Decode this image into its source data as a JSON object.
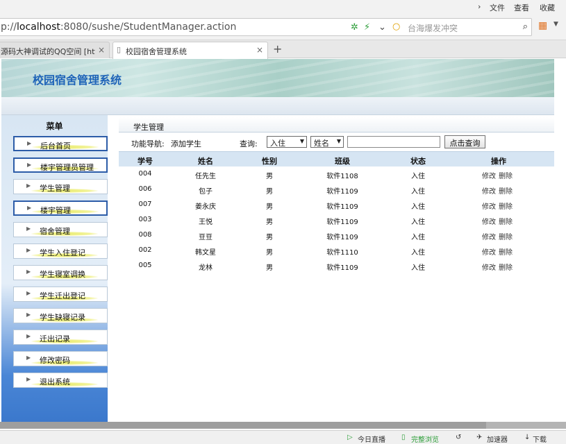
{
  "browser": {
    "menu": [
      "文件",
      "查看",
      "收藏"
    ],
    "url_prefix": "p://",
    "url_host": "localhost",
    "url_rest": ":8080/sushe/StudentManager.action",
    "search_placeholder": "台海爆发冲突",
    "tabs": [
      {
        "label": "源码大神调试的QQ空间 [http:",
        "active": false
      },
      {
        "label": "校园宿舍管理系统",
        "active": true
      }
    ],
    "new_tab": "+",
    "status": [
      "今日直播",
      "完整浏览",
      "加速器",
      "下载"
    ]
  },
  "header": {
    "system_title": "校园宿舍管理系统"
  },
  "sidebar": {
    "title": "菜单",
    "items": [
      {
        "label": "后台首页"
      },
      {
        "label": "楼宇管理员管理"
      },
      {
        "label": "学生管理"
      },
      {
        "label": "楼宇管理"
      },
      {
        "label": "宿舍管理"
      },
      {
        "label": "学生入住登记"
      },
      {
        "label": "学生寝室调换"
      },
      {
        "label": "学生迁出登记"
      },
      {
        "label": "学生缺寝记录"
      },
      {
        "label": "迁出记录"
      },
      {
        "label": "修改密码"
      },
      {
        "label": "退出系统"
      }
    ]
  },
  "main": {
    "breadcrumb": "学生管理",
    "toolbar": {
      "nav_label": "功能导航:",
      "add_link": "添加学生",
      "query_label": "查询:",
      "status_select": "入住",
      "field_select": "姓名",
      "query_value": "",
      "query_button": "点击查询"
    },
    "columns": [
      "学号",
      "姓名",
      "性别",
      "班级",
      "状态",
      "操作"
    ],
    "rows": [
      {
        "id": "004",
        "name": "任先生",
        "sex": "男",
        "class": "软件1108",
        "status": "入住",
        "edit": "修改",
        "delete": "删除"
      },
      {
        "id": "006",
        "name": "包子",
        "sex": "男",
        "class": "软件1109",
        "status": "入住",
        "edit": "修改",
        "delete": "删除"
      },
      {
        "id": "007",
        "name": "姜永庆",
        "sex": "男",
        "class": "软件1109",
        "status": "入住",
        "edit": "修改",
        "delete": "删除"
      },
      {
        "id": "003",
        "name": "王悦",
        "sex": "男",
        "class": "软件1109",
        "status": "入住",
        "edit": "修改",
        "delete": "删除"
      },
      {
        "id": "008",
        "name": "豆豆",
        "sex": "男",
        "class": "软件1109",
        "status": "入住",
        "edit": "修改",
        "delete": "删除"
      },
      {
        "id": "002",
        "name": "韩文星",
        "sex": "男",
        "class": "软件1110",
        "status": "入住",
        "edit": "修改",
        "delete": "删除"
      },
      {
        "id": "005",
        "name": "龙林",
        "sex": "男",
        "class": "软件1109",
        "status": "入住",
        "edit": "修改",
        "delete": "删除"
      }
    ]
  },
  "colors": {
    "title_blue": "#1e63b8",
    "header_row": "#d6e5f3",
    "sidebar_blue": "#3b78cc"
  }
}
